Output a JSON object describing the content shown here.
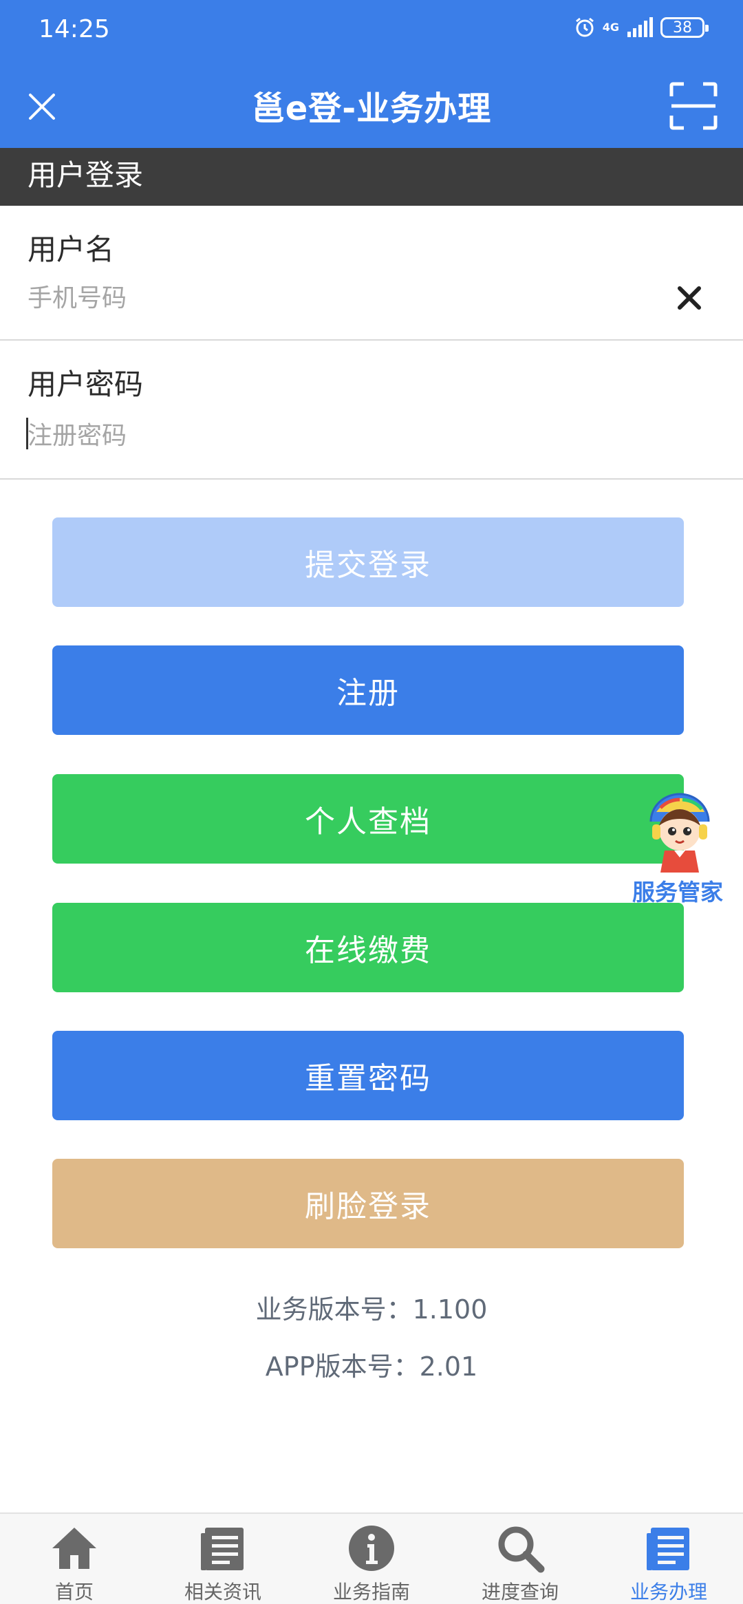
{
  "status_bar": {
    "time": "14:25",
    "network": "4G",
    "battery": "38"
  },
  "header": {
    "title": "邕e登-业务办理",
    "close_icon": "close-icon",
    "scan_icon": "scan-icon"
  },
  "section": {
    "title": "用户登录"
  },
  "form": {
    "username": {
      "label": "用户名",
      "placeholder": "手机号码",
      "value": ""
    },
    "password": {
      "label": "用户密码",
      "placeholder": "注册密码",
      "value": ""
    }
  },
  "buttons": {
    "submit": "提交登录",
    "register": "注册",
    "archive": "个人查档",
    "pay": "在线缴费",
    "reset": "重置密码",
    "face": "刷脸登录"
  },
  "assistant": {
    "label": "服务管家"
  },
  "versions": {
    "business": "业务版本号：1.100",
    "app": "APP版本号：2.01"
  },
  "tabs": [
    {
      "label": "首页",
      "icon": "home-icon"
    },
    {
      "label": "相关资讯",
      "icon": "news-icon"
    },
    {
      "label": "业务指南",
      "icon": "info-icon"
    },
    {
      "label": "进度查询",
      "icon": "search-icon"
    },
    {
      "label": "业务办理",
      "icon": "business-icon",
      "active": true
    }
  ],
  "colors": {
    "primary": "#3b7ee8",
    "primary_disabled": "#afcbf9",
    "green": "#36cc5e",
    "tan": "#dfb988",
    "section_bar": "#3d3d3d"
  }
}
